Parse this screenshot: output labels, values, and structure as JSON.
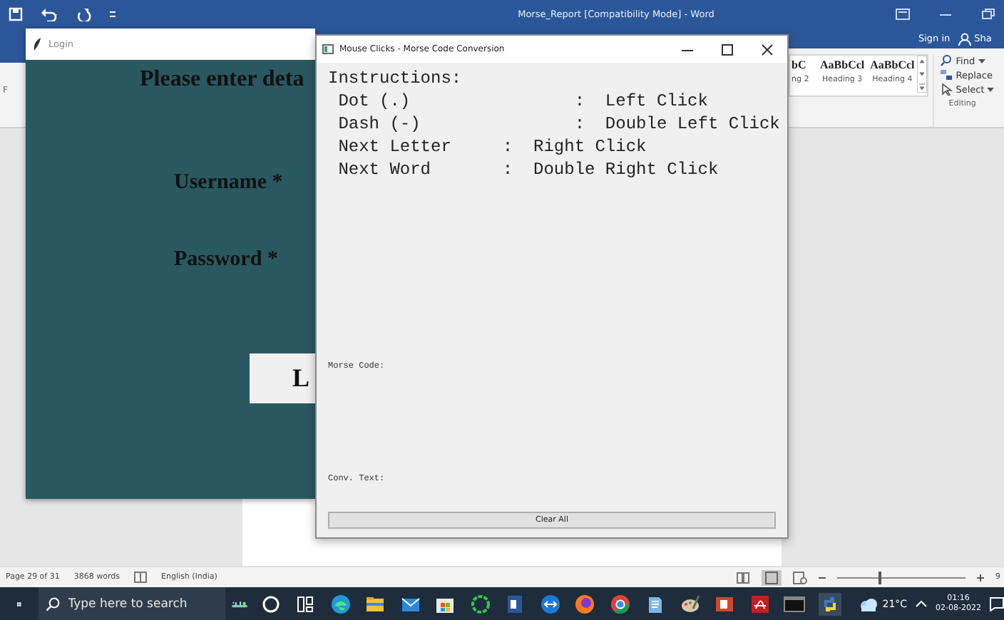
{
  "word": {
    "title": "Morse_Report [Compatibility Mode] - Word",
    "ribbon_fragment": "F",
    "account": {
      "sign_in": "Sign in",
      "share": "Sha"
    },
    "styles": [
      {
        "preview": "bC",
        "name": "ng 2"
      },
      {
        "preview": "AaBbCcl",
        "name": "Heading 3"
      },
      {
        "preview": "AaBbCcl",
        "name": "Heading 4"
      }
    ],
    "editing": {
      "commands": [
        {
          "label": "Find",
          "dropdown": true
        },
        {
          "label": "Replace",
          "dropdown": false
        },
        {
          "label": "Select",
          "dropdown": true
        }
      ],
      "group_label": "Editing"
    },
    "status_bar": {
      "page": "Page 29 of 31",
      "words": "3868 words",
      "language": "English (India)",
      "zoom": {
        "level": 0.33,
        "reading": "9"
      }
    }
  },
  "login": {
    "title": "Login",
    "heading": "Please enter deta",
    "fields": [
      {
        "label": "Username *"
      },
      {
        "label": "Password *"
      }
    ],
    "button": "L"
  },
  "morse": {
    "title": "Mouse Clicks - Morse Code Conversion",
    "instructions_title": "Instructions:",
    "instructions": [
      " Dot (.)                :  Left Click",
      " Dash (-)               :  Double Left Click",
      " Next Letter     :  Right Click",
      " Next Word       :  Double Right Click"
    ],
    "morse_code_label": "Morse Code:",
    "conv_text_label": "Conv. Text:",
    "clear_button": "Clear All"
  },
  "taskbar": {
    "search_placeholder": "Type here to search",
    "weather": "21°C",
    "time": "01:16",
    "date": "02-08-2022"
  }
}
